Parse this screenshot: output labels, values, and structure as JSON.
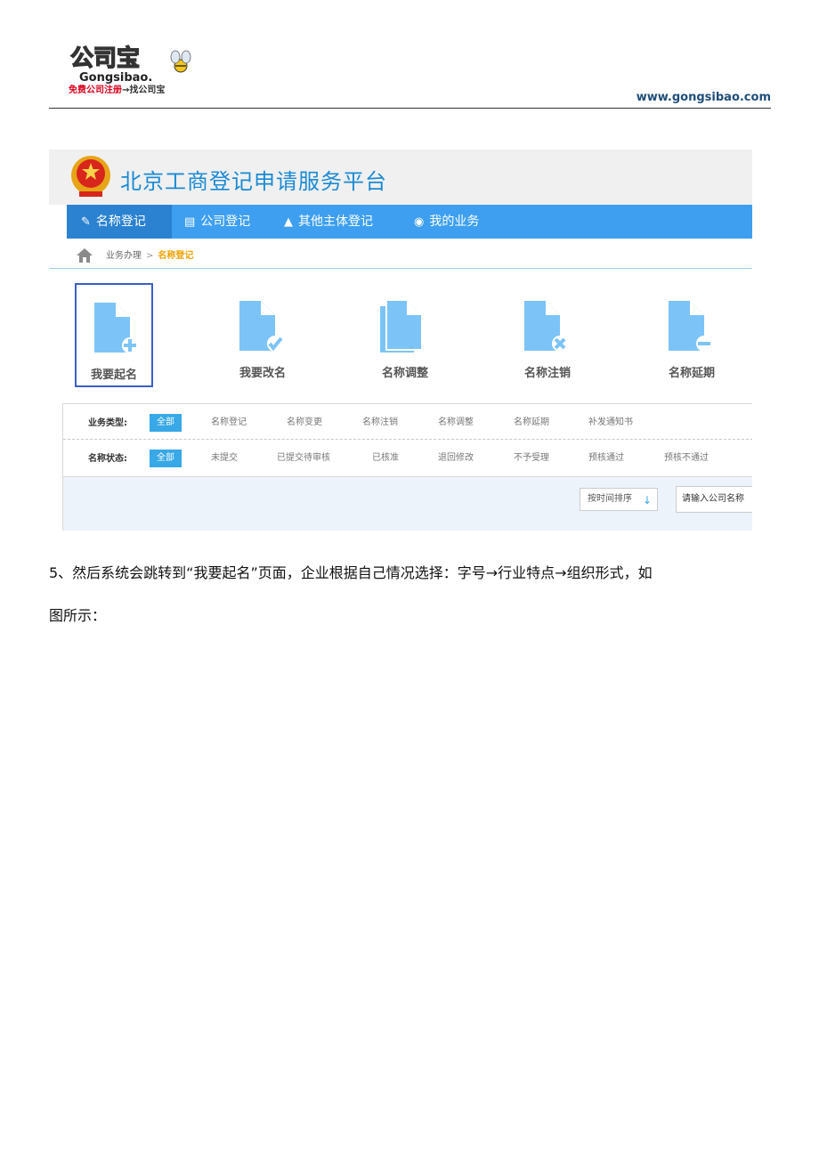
{
  "header": {
    "logo_text": "公司宝",
    "logo_sub": "Gongsibao",
    "tagline_red": "免费公司注册",
    "tagline_rest": "→找公司宝",
    "url": "www.gongsibao.com"
  },
  "platform": {
    "title": "北京工商登记申请服务平台"
  },
  "nav": {
    "items": [
      {
        "label": "名称登记",
        "icon": "edit-icon"
      },
      {
        "label": "公司登记",
        "icon": "document-icon"
      },
      {
        "label": "其他主体登记",
        "icon": "building-icon"
      },
      {
        "label": "我的业务",
        "icon": "user-circle-icon"
      }
    ]
  },
  "breadcrumb": {
    "parent": "业务办理",
    "separator": ">",
    "current": "名称登记"
  },
  "actions": [
    {
      "label": "我要起名",
      "icon": "file-plus-icon"
    },
    {
      "label": "我要改名",
      "icon": "file-check-icon"
    },
    {
      "label": "名称调整",
      "icon": "file-stack-icon"
    },
    {
      "label": "名称注销",
      "icon": "file-x-icon"
    },
    {
      "label": "名称延期",
      "icon": "file-minus-icon"
    }
  ],
  "filters": {
    "business_type": {
      "label": "业务类型:",
      "options": [
        "全部",
        "名称登记",
        "名称变更",
        "名称注销",
        "名称调整",
        "名称延期",
        "补发通知书"
      ]
    },
    "name_status": {
      "label": "名称状态:",
      "options": [
        "全部",
        "未提交",
        "已提交待审核",
        "已核准",
        "退回修改",
        "不予受理",
        "预核通过",
        "预核不通过"
      ]
    },
    "sort_label": "按时间排序",
    "search_placeholder": "请输入公司名称"
  },
  "body": {
    "line1": "5、然后系统会跳转到“我要起名”页面，企业根据自己情况选择：字号→行业特点→组织形式，如",
    "line2": "图所示："
  },
  "colors": {
    "nav_bg": "#3e9ff0",
    "nav_active": "#2b82d0",
    "title_blue": "#1a8ad4",
    "accent_chip": "#38a8e6",
    "breadcrumb_current": "#f4a100",
    "icon_blue": "#7cc4f8"
  }
}
